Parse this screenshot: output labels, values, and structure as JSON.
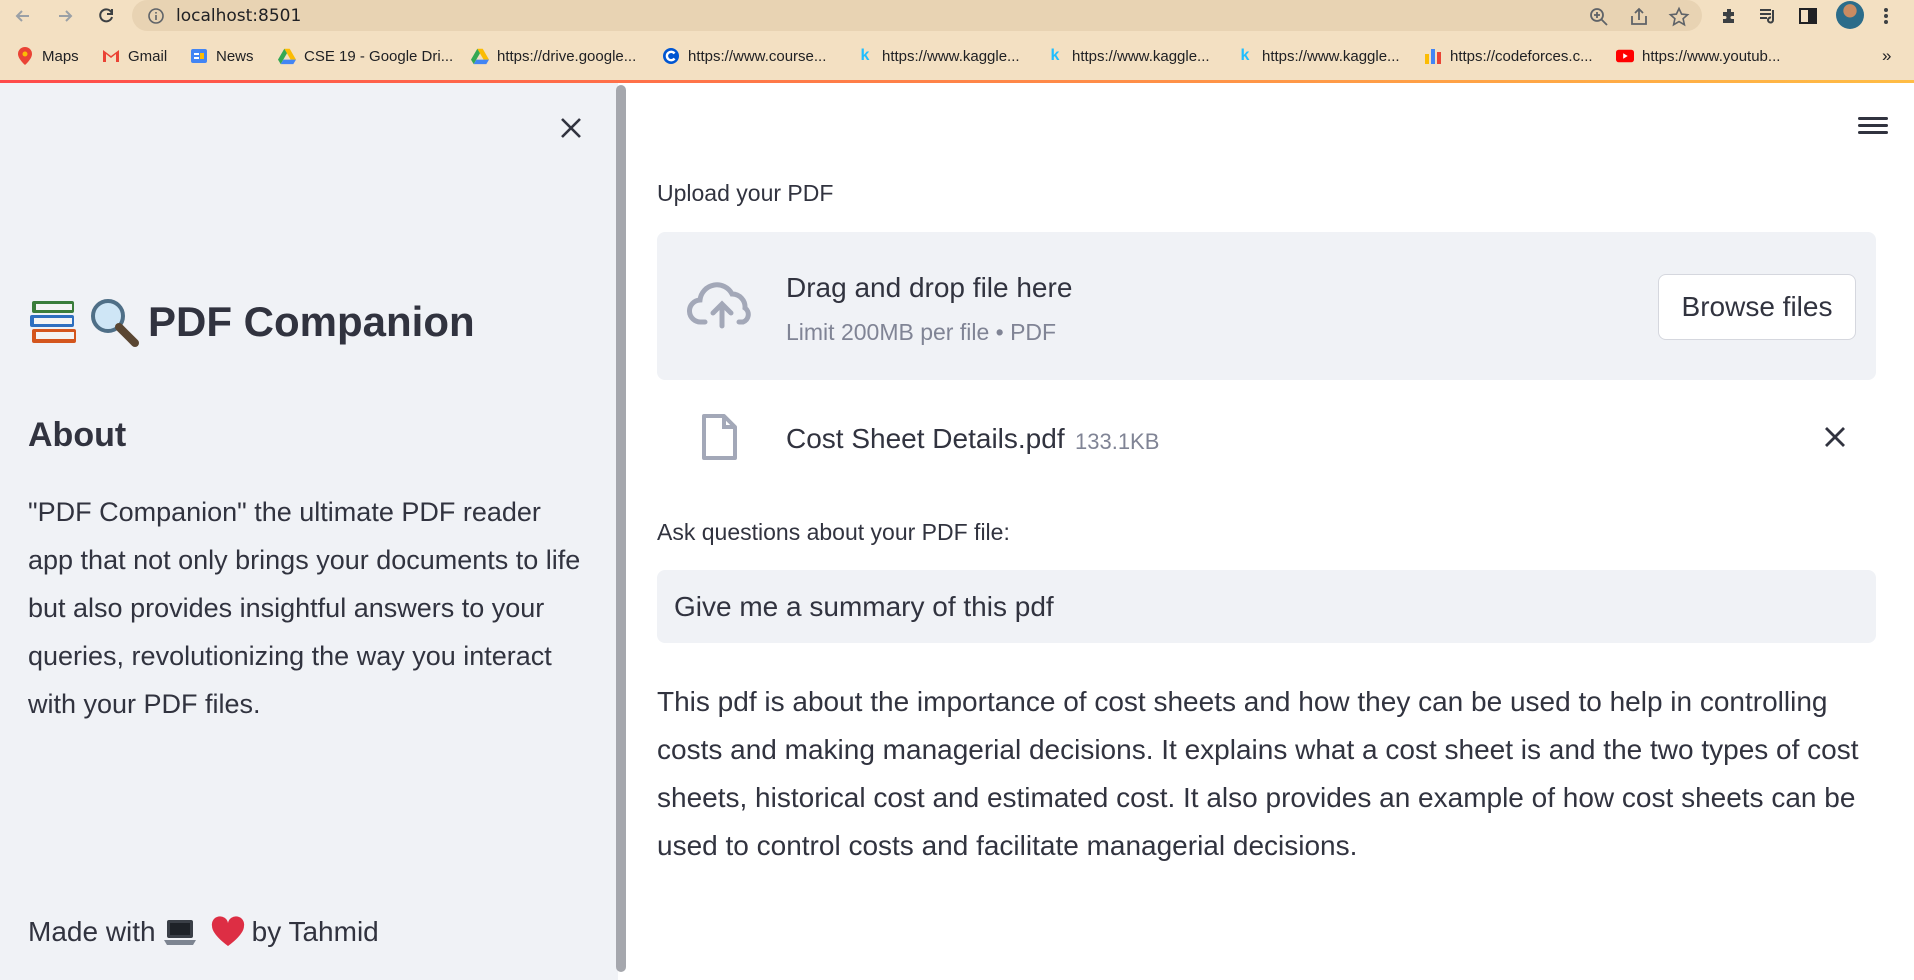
{
  "browser": {
    "url": "localhost:8501",
    "bookmarks": [
      {
        "label": "Maps",
        "icon": "maps-icon"
      },
      {
        "label": "Gmail",
        "icon": "gmail-icon"
      },
      {
        "label": "News",
        "icon": "news-icon"
      },
      {
        "label": "CSE 19 - Google Dri...",
        "icon": "drive-icon"
      },
      {
        "label": "https://drive.google...",
        "icon": "drive-icon"
      },
      {
        "label": "https://www.course...",
        "icon": "coursera-icon"
      },
      {
        "label": "https://www.kaggle...",
        "icon": "kaggle-icon"
      },
      {
        "label": "https://www.kaggle...",
        "icon": "kaggle-icon"
      },
      {
        "label": "https://www.kaggle...",
        "icon": "kaggle-icon"
      },
      {
        "label": "https://codeforces.c...",
        "icon": "codeforces-icon"
      },
      {
        "label": "https://www.youtub...",
        "icon": "youtube-icon"
      }
    ],
    "overflow": "»"
  },
  "sidebar": {
    "title": "PDF Companion",
    "about_heading": "About",
    "about_text": "\"PDF Companion\" the ultimate PDF reader app that not only brings your documents to life but also provides insightful answers to your queries, revolutionizing the way you interact with your PDF files.",
    "footer_prefix": "Made with",
    "footer_suffix": "by Tahmid"
  },
  "main": {
    "upload_label": "Upload your PDF",
    "dropzone_title": "Drag and drop file here",
    "dropzone_limit": "Limit 200MB per file • PDF",
    "browse_label": "Browse files",
    "file_name": "Cost Sheet Details.pdf",
    "file_size": "133.1KB",
    "ask_label": "Ask questions about your PDF file:",
    "query_value": "Give me a summary of this pdf",
    "answer": "This pdf is about the importance of cost sheets and how they can be used to help in controlling costs and making managerial decisions. It explains what a cost sheet is and the two types of cost sheets, historical cost and estimated cost. It also provides an example of how cost sheets can be used to control costs and facilitate managerial decisions."
  },
  "colors": {
    "chrome": "#f3e0c2",
    "sidebar_bg": "#f0f2f6",
    "text": "#31333f",
    "muted": "#808495",
    "accent_start": "#ff4b4b",
    "accent_end": "#ffbd45"
  }
}
